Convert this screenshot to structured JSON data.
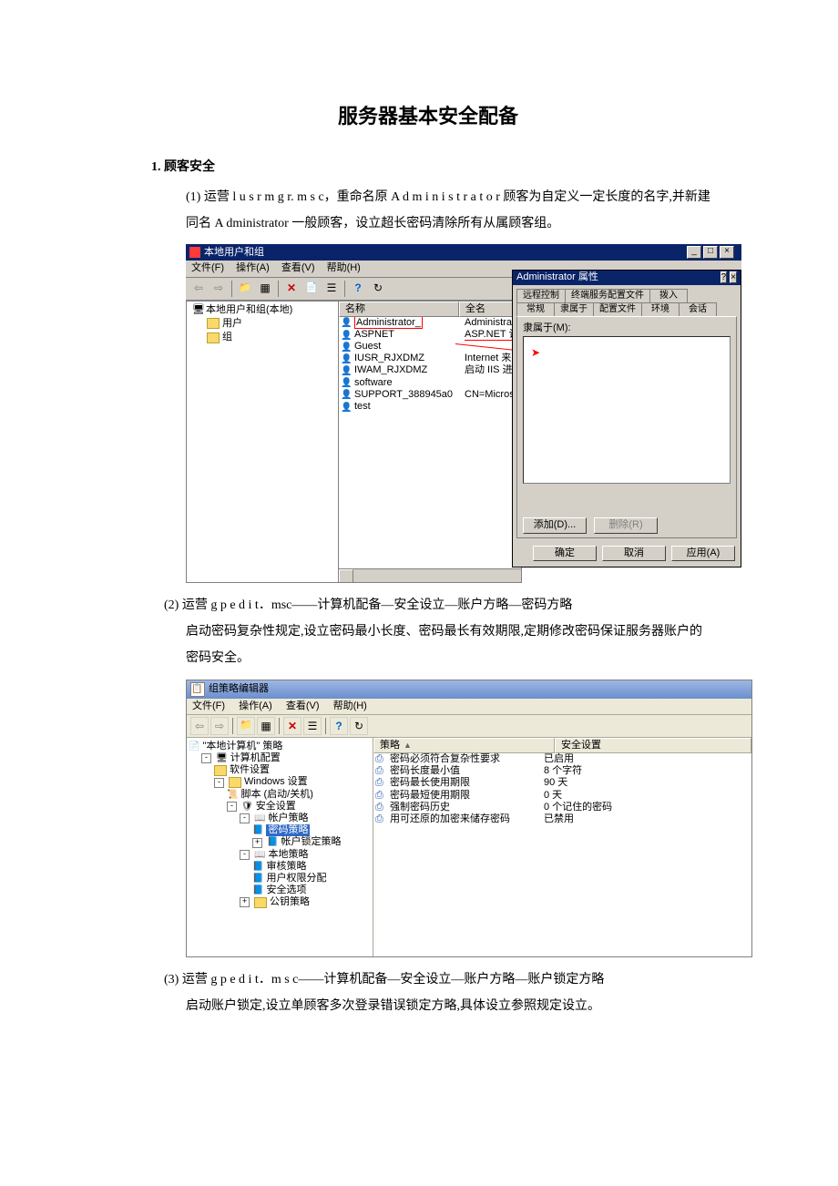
{
  "doc": {
    "title": "服务器基本安全配备",
    "section1_heading": "顾客安全",
    "item1_a": "运营 l u s r m g r. m s c，重命名原 A d m i n i s t r a t o r 顾客为自定义一定长度的名字,并新建同名 A dministrator 一般顾客，设立超长密码清除所有从属顾客组。",
    "item2_a": "运营 g p e d i t．msc——计算机配备—安全设立—账户方略—密码方略",
    "item2_b": "启动密码复杂性规定,设立密码最小长度、密码最长有效期限,定期修改密码保证服务器账户的密码安全。",
    "item3_a": "运营 g p e d i t．m s c——计算机配备—安全设立—账户方略—账户锁定方略",
    "item3_b": "启动账户锁定,设立单顾客多次登录错误锁定方略,具体设立参照规定设立。",
    "labels": {
      "n1": "(1)",
      "n2": "(2)",
      "n3": "(3)"
    }
  },
  "lusrmgr": {
    "title": "本地用户和组",
    "menu": {
      "file": "文件(F)",
      "action": "操作(A)",
      "view": "查看(V)",
      "help": "帮助(H)"
    },
    "tree": {
      "root": "本地用户和组(本地)",
      "users": "用户",
      "groups": "组"
    },
    "cols": {
      "name": "名称",
      "full": "全名"
    },
    "users": [
      {
        "name": "Administrator_",
        "full": "Administrator",
        "redbox": true
      },
      {
        "name": "ASPNET",
        "full": "ASP.NET 计算机帐户",
        "redline": true
      },
      {
        "name": "Guest",
        "full": ""
      },
      {
        "name": "IUSR_RJXDMZ",
        "full": "Internet 来宾帐户"
      },
      {
        "name": "IWAM_RJXDMZ",
        "full": "启动 IIS 进程帐户"
      },
      {
        "name": "software",
        "full": ""
      },
      {
        "name": "SUPPORT_388945a0",
        "full": "CN=Microsoft Corpora…"
      },
      {
        "name": "test",
        "full": ""
      }
    ],
    "prop": {
      "title": "Administrator 属性",
      "tabs_row1": [
        "远程控制",
        "终端服务配置文件",
        "拨入"
      ],
      "tabs_row2": [
        "常规",
        "隶属于",
        "配置文件",
        "环境",
        "会话"
      ],
      "member_label": "隶属于(M):",
      "add": "添加(D)...",
      "remove": "删除(R)",
      "ok": "确定",
      "cancel": "取消",
      "apply": "应用(A)"
    }
  },
  "gpedit": {
    "title": "组策略编辑器",
    "menu": {
      "file": "文件(F)",
      "action": "操作(A)",
      "view": "查看(V)",
      "help": "帮助(H)"
    },
    "tree": {
      "root": "\"本地计算机\" 策略",
      "comp": "计算机配置",
      "soft": "软件设置",
      "win": "Windows 设置",
      "scripts": "脚本 (启动/关机)",
      "sec": "安全设置",
      "acct": "帐户策略",
      "pwd": "密码策略",
      "lock": "帐户锁定策略",
      "local": "本地策略",
      "audit": "审核策略",
      "rights": "用户权限分配",
      "opts": "安全选项",
      "pki": "公钥策略"
    },
    "cols": {
      "policy": "策略",
      "setting": "安全设置"
    },
    "rows": [
      {
        "p": "密码必须符合复杂性要求",
        "s": "已启用"
      },
      {
        "p": "密码长度最小值",
        "s": "8 个字符"
      },
      {
        "p": "密码最长使用期限",
        "s": "90 天"
      },
      {
        "p": "密码最短使用期限",
        "s": "0 天"
      },
      {
        "p": "强制密码历史",
        "s": "0 个记住的密码"
      },
      {
        "p": "用可还原的加密来储存密码",
        "s": "已禁用"
      }
    ]
  }
}
